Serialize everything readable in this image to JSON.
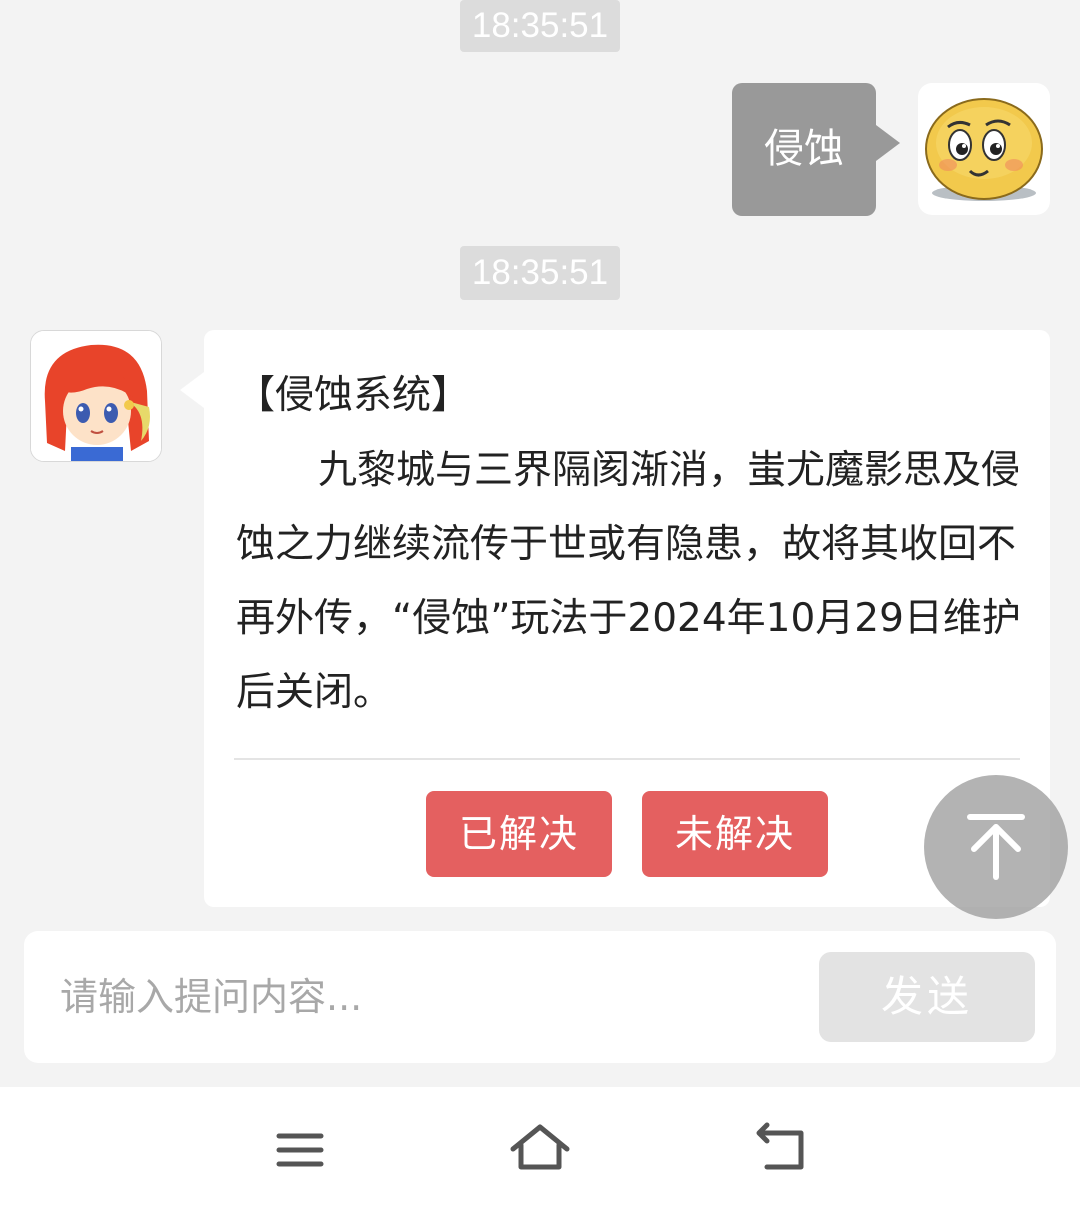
{
  "chat": {
    "messages": [
      {
        "timestamp": "18:35:51",
        "sender": "user",
        "text": "侵蚀"
      },
      {
        "timestamp": "18:35:51",
        "sender": "bot",
        "title": "【侵蚀系统】",
        "body": "九黎城与三界隔阂渐消，蚩尤魔影思及侵蚀之力继续流传于世或有隐患，故将其收回不再外传，“侵蚀”玩法于2024年10月29日维护后关闭。",
        "actions": {
          "solved": "已解决",
          "unsolved": "未解决"
        }
      }
    ]
  },
  "input": {
    "placeholder": "请输入提问内容...",
    "value": "",
    "send_label": "发送"
  },
  "icons": {
    "scroll_top": "arrow-up-to-top-icon",
    "nav_menu": "menu-icon",
    "nav_home": "home-icon",
    "nav_back": "back-icon"
  },
  "colors": {
    "background": "#f3f3f3",
    "user_bubble": "#999999",
    "action_button": "#e46060",
    "send_button_disabled": "#e3e3e3",
    "timestamp_bg": "#dcdcdc"
  }
}
